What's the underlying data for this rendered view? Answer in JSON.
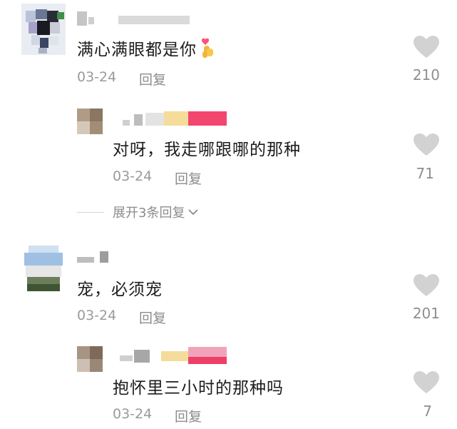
{
  "comments": [
    {
      "text": "满心满眼都是你",
      "emoji": "finger-heart-icon",
      "date": "03-24",
      "reply_label": "回复",
      "likes": "210",
      "replies": [
        {
          "text": "对呀，我走哪跟哪的那种",
          "date": "03-24",
          "reply_label": "回复",
          "likes": "71"
        }
      ],
      "expand_label": "展开3条回复"
    },
    {
      "text": "宠，必须宠",
      "date": "03-24",
      "reply_label": "回复",
      "likes": "201",
      "replies": [
        {
          "text": "抱怀里三小时的那种吗",
          "date": "03-24",
          "reply_label": "回复",
          "likes": "7"
        }
      ]
    }
  ],
  "colors": {
    "heart": "#d2d2d2",
    "meta": "#9a9a9a",
    "text": "#1c1c1c"
  }
}
